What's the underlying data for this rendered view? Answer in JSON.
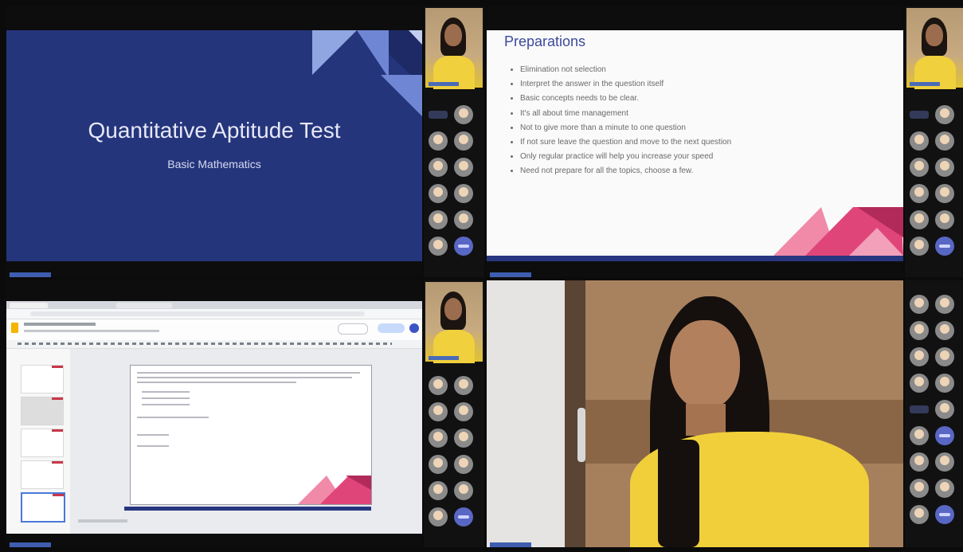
{
  "slide_title": {
    "title": "Quantitative Aptitude Test",
    "subtitle": "Basic Mathematics"
  },
  "slide_preparations": {
    "heading": "Preparations",
    "bullets": [
      "Elimination not selection",
      "Interpret the answer in the question itself",
      "Basic concepts needs to be clear.",
      "It's all about time management",
      "Not to give more than a minute to one question",
      "If not sure leave the question and move to the next question",
      "Only regular practice will help you increase your speed",
      "Need not prepare for all the topics, choose a few."
    ]
  },
  "colors": {
    "slide_navy": "#25357c",
    "slide_bar": "#27367f",
    "accent_pink": "#e0457a",
    "heading_blue": "#3b4a9c",
    "name_tag": "#3f5db0"
  },
  "icons": [
    "participant-avatar-icon",
    "camera-feed"
  ]
}
